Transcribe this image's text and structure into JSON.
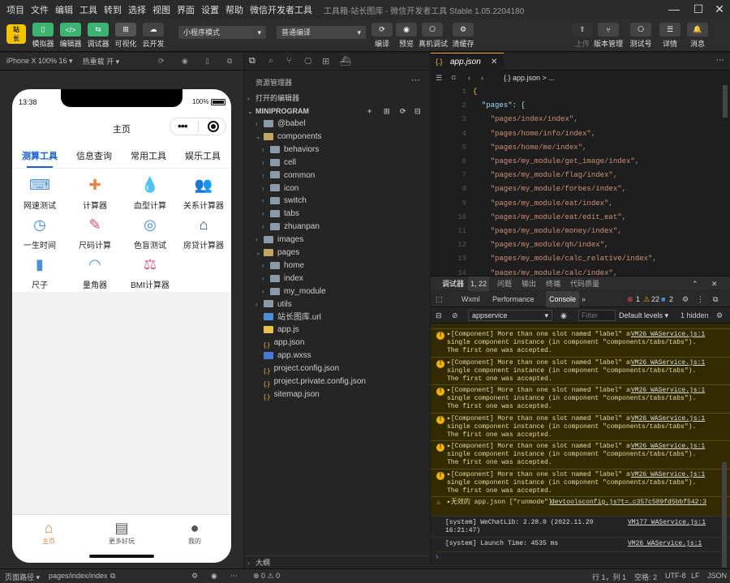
{
  "menubar": {
    "items": [
      "项目",
      "文件",
      "编辑",
      "工具",
      "转到",
      "选择",
      "视图",
      "界面",
      "设置",
      "帮助",
      "微信开发者工具"
    ],
    "title": "工具箱-站长图库 - 微信开发者工具 Stable 1.05.2204180"
  },
  "toolbar": {
    "left_buttons": [
      {
        "label": "模拟器",
        "icon": "phone-icon",
        "color": "#3cb371"
      },
      {
        "label": "编辑器",
        "icon": "code-icon",
        "color": "#3cb371"
      },
      {
        "label": "调试器",
        "icon": "debug-icon",
        "color": "#3cb371"
      },
      {
        "label": "可视化",
        "icon": "layout-icon",
        "color": "#555555"
      },
      {
        "label": "云开发",
        "icon": "cloud-icon",
        "color": "#444444"
      }
    ],
    "mode_select": "小程序模式",
    "compile_select": "普通编译",
    "mid_buttons": [
      "编译",
      "预览",
      "真机调试",
      "清缓存"
    ],
    "right_buttons": [
      "上传",
      "版本管理",
      "测试号",
      "详情",
      "消息"
    ]
  },
  "simulator": {
    "device": "iPhone X 100% 16 ▾",
    "hot_reload": "热重载 开 ▾",
    "time": "13:38",
    "battery": "100%",
    "page_title": "主页",
    "tabs": [
      "测算工具",
      "信息查询",
      "常用工具",
      "娱乐工具"
    ],
    "grid": [
      {
        "label": "网速测试",
        "icon": "speed-icon",
        "glyph": "⌨",
        "color": "#4a90d9"
      },
      {
        "label": "计算器",
        "icon": "calculator-icon",
        "glyph": "✚",
        "color": "#e8844a"
      },
      {
        "label": "血型计算",
        "icon": "blood-type-icon",
        "glyph": "💧",
        "color": "#e05a8a"
      },
      {
        "label": "关系计算器",
        "icon": "relations-icon",
        "glyph": "👥",
        "color": "#e05a8a"
      },
      {
        "label": "一生时间",
        "icon": "clock-icon",
        "glyph": "◷",
        "color": "#3d8fd9"
      },
      {
        "label": "尺码计算",
        "icon": "ruler-pencil-icon",
        "glyph": "✎",
        "color": "#d94a6a"
      },
      {
        "label": "色盲测试",
        "icon": "target-icon",
        "glyph": "◎",
        "color": "#3d8fd9"
      },
      {
        "label": "房贷计算器",
        "icon": "house-loan-icon",
        "glyph": "⌂",
        "color": "#2b3f8c"
      },
      {
        "label": "尺子",
        "icon": "ruler-icon",
        "glyph": "▮",
        "color": "#4a90d9"
      },
      {
        "label": "量角器",
        "icon": "protractor-icon",
        "glyph": "◠",
        "color": "#4a90d9"
      },
      {
        "label": "BMI计算器",
        "icon": "bmi-icon",
        "glyph": "⚖",
        "color": "#e05a8a"
      }
    ],
    "tabbar": [
      {
        "label": "主页",
        "icon": "home-icon",
        "color": "#e8844a"
      },
      {
        "label": "更多好玩",
        "icon": "more-icon",
        "color": "#555555"
      },
      {
        "label": "我的",
        "icon": "user-icon",
        "color": "#555555"
      }
    ]
  },
  "explorer": {
    "title": "资源管理器",
    "open_editors": "打开的编辑器",
    "root": "MINIPROGRAM",
    "tree": [
      {
        "name": "@babel",
        "type": "folder",
        "depth": 1,
        "open": false
      },
      {
        "name": "components",
        "type": "folder",
        "depth": 1,
        "open": true
      },
      {
        "name": "behaviors",
        "type": "folder",
        "depth": 2,
        "open": false
      },
      {
        "name": "cell",
        "type": "folder",
        "depth": 2,
        "open": false
      },
      {
        "name": "common",
        "type": "folder",
        "depth": 2,
        "open": false
      },
      {
        "name": "icon",
        "type": "folder",
        "depth": 2,
        "open": false
      },
      {
        "name": "switch",
        "type": "folder",
        "depth": 2,
        "open": false
      },
      {
        "name": "tabs",
        "type": "folder",
        "depth": 2,
        "open": false
      },
      {
        "name": "zhuanpan",
        "type": "folder",
        "depth": 2,
        "open": false
      },
      {
        "name": "images",
        "type": "folder",
        "depth": 1,
        "open": false
      },
      {
        "name": "pages",
        "type": "folder",
        "depth": 1,
        "open": true
      },
      {
        "name": "home",
        "type": "folder",
        "depth": 2,
        "open": false
      },
      {
        "name": "index",
        "type": "folder",
        "depth": 2,
        "open": false
      },
      {
        "name": "my_module",
        "type": "folder",
        "depth": 2,
        "open": false
      },
      {
        "name": "utils",
        "type": "folder",
        "depth": 1,
        "open": false
      },
      {
        "name": "站长图库.url",
        "type": "url",
        "depth": 1
      },
      {
        "name": "app.js",
        "type": "js",
        "depth": 1
      },
      {
        "name": "app.json",
        "type": "json",
        "depth": 1
      },
      {
        "name": "app.wxss",
        "type": "css",
        "depth": 1
      },
      {
        "name": "project.config.json",
        "type": "json",
        "depth": 1
      },
      {
        "name": "project.private.config.json",
        "type": "json",
        "depth": 1
      },
      {
        "name": "sitemap.json",
        "type": "json",
        "depth": 1
      }
    ],
    "outline": "大纲"
  },
  "editor": {
    "tab": "app.json",
    "breadcrumb": "{.} app.json > ...",
    "lines": [
      {
        "n": "1",
        "text": "{"
      },
      {
        "n": "2",
        "text": "  \"pages\": ["
      },
      {
        "n": "3",
        "text": "    \"pages/index/index\","
      },
      {
        "n": "4",
        "text": "    \"pages/home/info/index\","
      },
      {
        "n": "5",
        "text": "    \"pages/home/me/index\","
      },
      {
        "n": "6",
        "text": "    \"pages/my_module/get_image/index\","
      },
      {
        "n": "7",
        "text": "    \"pages/my_module/flag/index\","
      },
      {
        "n": "8",
        "text": "    \"pages/my_module/forbes/index\","
      },
      {
        "n": "9",
        "text": "    \"pages/my_module/eat/index\","
      },
      {
        "n": "10",
        "text": "    \"pages/my_module/eat/edit_eat\","
      },
      {
        "n": "11",
        "text": "    \"pages/my_module/money/index\","
      },
      {
        "n": "12",
        "text": "    \"pages/my_module/qh/index\","
      },
      {
        "n": "13",
        "text": "    \"pages/my_module/calc_relative/index\","
      },
      {
        "n": "14",
        "text": "    \"pages/my_module/calc/index\","
      }
    ]
  },
  "devtools": {
    "tabs": [
      "调试器",
      "1, 22",
      "问题",
      "输出",
      "终端",
      "代码质量"
    ],
    "subtabs": [
      "Wxml",
      "Performance",
      "Console"
    ],
    "errors": "1",
    "warnings": "22",
    "infos": "2",
    "context": "appservice",
    "filter_placeholder": "Filter",
    "levels": "Default levels ▾",
    "hidden": "1 hidden",
    "warn_msgs": [
      {
        "text": "▸[Component] More than one slot named \"label\" are found inside a single component instance (in component \"components/tabs/tabs\"). The first one was accepted.",
        "src": "VM26 WAService.js:1"
      },
      {
        "text": "▸[Component] More than one slot named \"label\" are found inside a single component instance (in component \"components/tabs/tabs\"). The first one was accepted.",
        "src": "VM26 WAService.js:1"
      },
      {
        "text": "▸[Component] More than one slot named \"label\" are found inside a single component instance (in component \"components/tabs/tabs\"). The first one was accepted.",
        "src": "VM26 WAService.js:1"
      },
      {
        "text": "▸[Component] More than one slot named \"label\" are found inside a single component instance (in component \"components/tabs/tabs\"). The first one was accepted.",
        "src": "VM26 WAService.js:1"
      },
      {
        "text": "▸[Component] More than one slot named \"label\" are found inside a single component instance (in component \"components/tabs/tabs\"). The first one was accepted.",
        "src": "VM26 WAService.js:1"
      },
      {
        "text": "▸[Component] More than one slot named \"label\" are found inside a single component instance (in component \"components/tabs/tabs\"). The first one was accepted.",
        "src": "VM26 WAService.js:1"
      }
    ],
    "json_warn": {
      "text": "▸无效的 app.json [\"runmode\"]",
      "src": "devtoolsconfig.js?t=…c357c589fd5bbf542:3"
    },
    "info_msgs": [
      {
        "text": "[system] WeChatLib: 2.28.0 (2022.11.29 16:21:47)",
        "src": "VM177 WAService.js:1"
      },
      {
        "text": "[system] Launch Time: 4535 ms",
        "src": "VM26 WAService.js:1"
      }
    ],
    "prompt": "›"
  },
  "statusbar": {
    "path_label": "页面路径 ▾",
    "path": "pages/index/index",
    "problems": "⊗ 0 ⚠ 0",
    "position": "行 1，列 1",
    "spaces": "空格: 2",
    "encoding": "UTF-8",
    "eol": "LF",
    "lang": "JSON"
  }
}
